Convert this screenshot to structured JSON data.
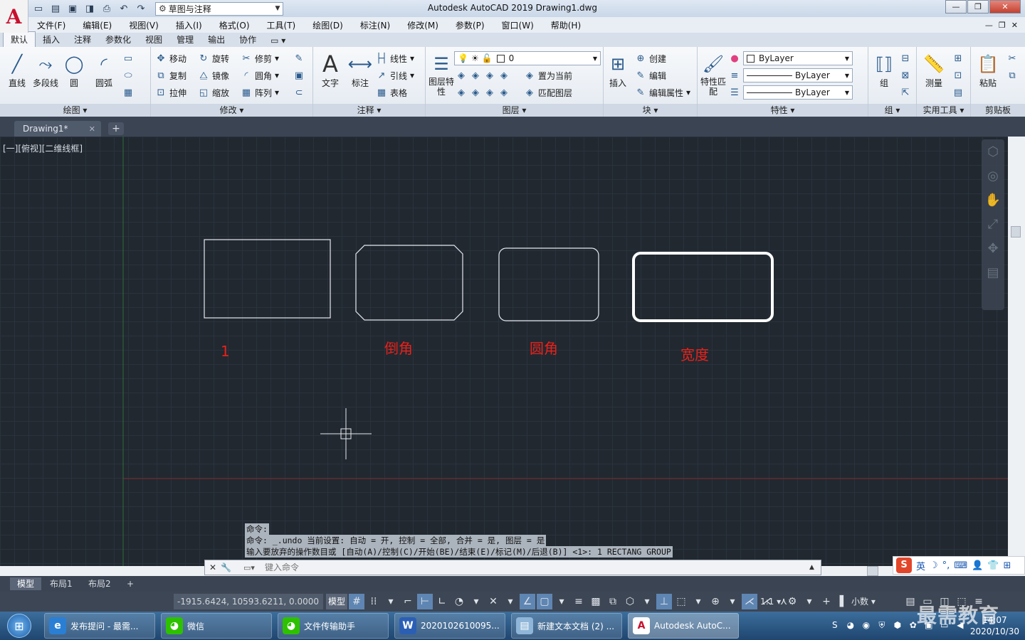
{
  "title": {
    "app_letter": "A",
    "text": "Autodesk AutoCAD 2019    Drawing1.dwg",
    "workspace": "草图与注释"
  },
  "menu": [
    "文件(F)",
    "编辑(E)",
    "视图(V)",
    "插入(I)",
    "格式(O)",
    "工具(T)",
    "绘图(D)",
    "标注(N)",
    "修改(M)",
    "参数(P)",
    "窗口(W)",
    "帮助(H)"
  ],
  "ribbon_tabs": [
    "默认",
    "插入",
    "注释",
    "参数化",
    "视图",
    "管理",
    "输出",
    "协作"
  ],
  "ribbon": {
    "draw": {
      "title": "绘图",
      "line": "直线",
      "polyline": "多段线",
      "circle": "圆",
      "arc": "圆弧"
    },
    "modify": {
      "title": "修改",
      "move": "移动",
      "rotate": "旋转",
      "trim": "修剪",
      "copy": "复制",
      "mirror": "镜像",
      "fillet": "圆角",
      "stretch": "拉伸",
      "scale": "缩放",
      "array": "阵列"
    },
    "annotation": {
      "title": "注释",
      "text": "文字",
      "dimension": "标注",
      "linear": "线性",
      "leader": "引线",
      "table": "表格"
    },
    "layers": {
      "title": "图层",
      "properties": "图层特性",
      "layer_value": "0",
      "make_current": "置为当前",
      "match": "匹配图层"
    },
    "block": {
      "title": "块",
      "insert": "插入",
      "create": "创建",
      "edit": "编辑",
      "edit_attr": "编辑属性"
    },
    "properties": {
      "title": "特性",
      "match": "特性匹配",
      "color": "ByLayer",
      "linetype": "ByLayer",
      "lineweight": "ByLayer"
    },
    "groups": {
      "title": "组",
      "group": "组"
    },
    "utilities": {
      "title": "实用工具",
      "measure": "测量"
    },
    "clipboard": {
      "title": "剪贴板",
      "paste": "粘贴"
    }
  },
  "file_tab": "Drawing1*",
  "view_label": "[一][俯视][二维线框]",
  "labels": {
    "rect1": "1",
    "chamfer": "倒角",
    "fillet": "圆角",
    "width": "宽度"
  },
  "command_history": [
    "命令:",
    "命令: _.undo 当前设置: 自动 = 开, 控制 = 全部, 合并 = 是, 图层 = 是",
    "输入要放弃的操作数目或 [自动(A)/控制(C)/开始(BE)/结束(E)/标记(M)/后退(B)] <1>: 1 RECTANG GROUP"
  ],
  "command_placeholder": "键入命令",
  "layout_tabs": [
    "模型",
    "布局1",
    "布局2"
  ],
  "status": {
    "coords": "-1915.6424, 10593.6211, 0.0000",
    "model": "模型",
    "scale": "1:1",
    "units": "小数"
  },
  "ime": {
    "mode": "英"
  },
  "taskbar": [
    {
      "label": "发布提问 - 最需...",
      "icon": "ie-icon",
      "color": "#2a7fd4"
    },
    {
      "label": "微信",
      "icon": "wechat-icon",
      "color": "#2dc100"
    },
    {
      "label": "文件传输助手",
      "icon": "wechat-icon",
      "color": "#2dc100"
    },
    {
      "label": "2020102610095...",
      "icon": "word-icon",
      "color": "#2b5fb4"
    },
    {
      "label": "新建文本文档 (2) ...",
      "icon": "notepad-icon",
      "color": "#8fb6d8"
    },
    {
      "label": "Autodesk AutoC...",
      "icon": "autocad-icon",
      "color": "#c8102e"
    }
  ],
  "clock": {
    "time": "14:07",
    "date": "2020/10/30"
  },
  "watermark": "最需教育",
  "colors": {
    "label_red": "#e8211a",
    "canvas_bg": "#212830",
    "accent": "#5f86b3"
  }
}
